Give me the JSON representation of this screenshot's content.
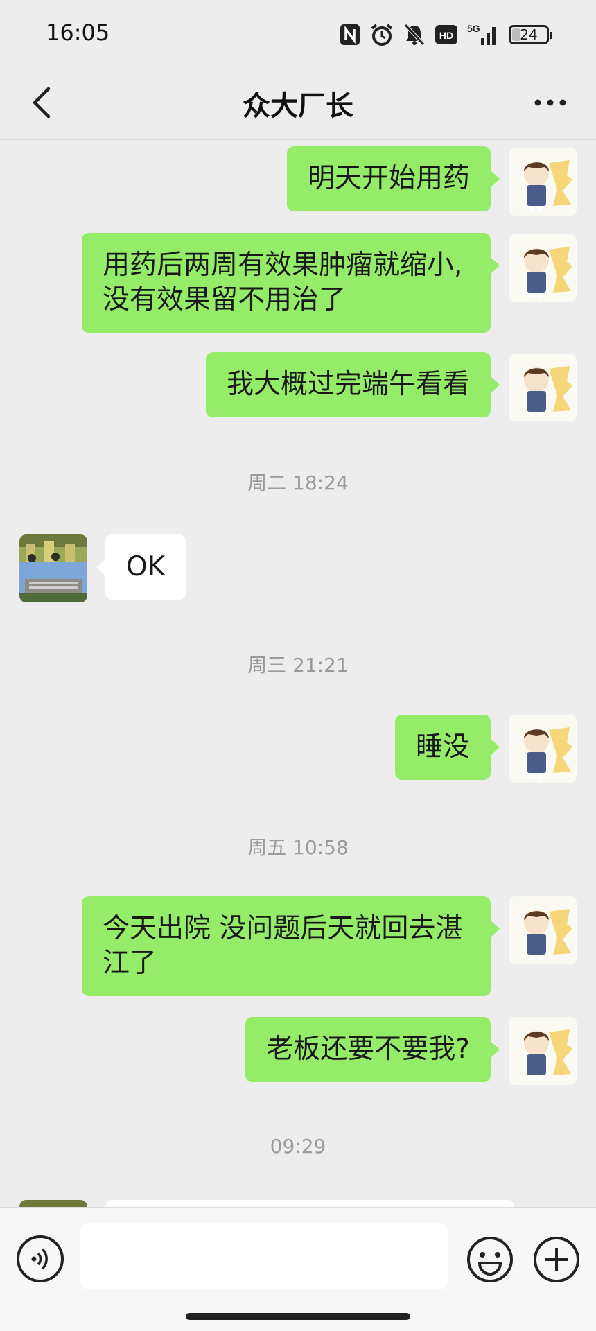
{
  "status_bar": {
    "time": "16:05",
    "icons": [
      "nfc-icon",
      "alarm-icon",
      "mute-icon",
      "hd-icon",
      "5g-signal-icon",
      "battery-icon"
    ],
    "hd_label": "HD",
    "network_label": "5G",
    "battery_level": "24"
  },
  "header": {
    "title": "众大厂长",
    "back_icon": "chevron-left-icon",
    "more_icon": "more-dots-icon"
  },
  "messages": [
    {
      "type": "out",
      "text": "明天开始用药"
    },
    {
      "type": "out",
      "text": "用药后两周有效果肿瘤就缩小,没有效果留不用治了"
    },
    {
      "type": "out",
      "text": "我大概过完端午看看"
    },
    {
      "type": "time",
      "text": "周二 18:24"
    },
    {
      "type": "in",
      "text": "OK"
    },
    {
      "type": "time",
      "text": "周三 21:21"
    },
    {
      "type": "out",
      "text": "睡没"
    },
    {
      "type": "time",
      "text": "周五 10:58"
    },
    {
      "type": "out",
      "text": "今天出院  没问题后天就回去湛江了"
    },
    {
      "type": "out",
      "text": "老板还要不要我?"
    },
    {
      "type": "time",
      "text": "09:29"
    }
  ],
  "input_bar": {
    "voice_icon": "voice-input-icon",
    "text_value": "",
    "emoji_icon": "emoji-icon",
    "plus_icon": "plus-circle-icon"
  },
  "colors": {
    "chat_background": "#ededed",
    "outgoing_bubble": "#95ec69",
    "incoming_bubble": "#ffffff",
    "timestamp_text": "#9a9a9a"
  }
}
